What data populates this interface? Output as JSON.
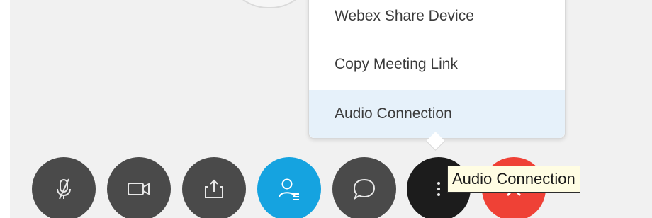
{
  "menu": {
    "items": [
      {
        "label": "Webex Share Device"
      },
      {
        "label": "Copy Meeting Link"
      },
      {
        "label": "Audio Connection",
        "highlighted": true
      }
    ]
  },
  "tooltip": {
    "text": "Audio Connection"
  },
  "controls": [
    {
      "name": "mute",
      "icon": "microphone-muted-icon",
      "color": "#4a4a4a"
    },
    {
      "name": "video",
      "icon": "video-camera-icon",
      "color": "#4a4a4a"
    },
    {
      "name": "share",
      "icon": "share-upload-icon",
      "color": "#4a4a4a"
    },
    {
      "name": "participants",
      "icon": "participants-list-icon",
      "color": "#15a3e0"
    },
    {
      "name": "chat",
      "icon": "chat-bubble-icon",
      "color": "#4a4a4a"
    },
    {
      "name": "more-options",
      "icon": "more-vertical-icon",
      "color": "#1c1c1c"
    },
    {
      "name": "end-meeting",
      "icon": "end-call-icon",
      "color": "#ef4136"
    }
  ],
  "colors": {
    "background": "#f1f1f1",
    "menu_highlight": "#e6f1fa",
    "tooltip_bg": "#fffde3"
  }
}
